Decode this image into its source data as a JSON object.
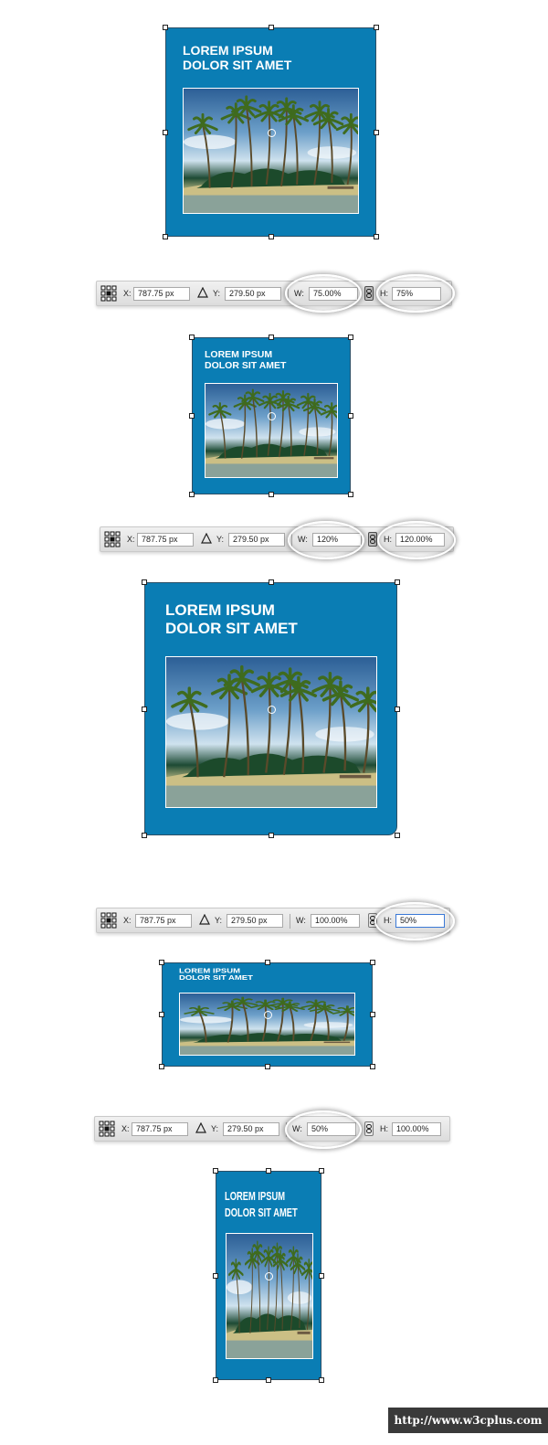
{
  "design_card": {
    "title_line1": "LOREM IPSUM",
    "title_line2": "DOLOR SIT AMET",
    "background_color": "#0a7db4",
    "photo": "tropical-island-palm-trees"
  },
  "toolbars": [
    {
      "x_label": "X:",
      "x_value": "787.75 px",
      "y_label": "Y:",
      "y_value": "279.50 px",
      "w_label": "W:",
      "w_value": "75.00%",
      "h_label": "H:",
      "h_value": "75%",
      "link_enabled": true,
      "highlighted": [
        "W",
        "H"
      ]
    },
    {
      "x_label": "X:",
      "x_value": "787.75 px",
      "y_label": "Y:",
      "y_value": "279.50 px",
      "w_label": "W:",
      "w_value": "120%",
      "h_label": "H:",
      "h_value": "120.00%",
      "link_enabled": true,
      "highlighted": [
        "W",
        "H"
      ]
    },
    {
      "x_label": "X:",
      "x_value": "787.75 px",
      "y_label": "Y:",
      "y_value": "279.50 px",
      "w_label": "W:",
      "w_value": "100.00%",
      "h_label": "H:",
      "h_value": "50%",
      "link_enabled": false,
      "highlighted": [
        "H"
      ]
    },
    {
      "x_label": "X:",
      "x_value": "787.75 px",
      "y_label": "Y:",
      "y_value": "279.50 px",
      "w_label": "W:",
      "w_value": "50%",
      "h_label": "H:",
      "h_value": "100.00%",
      "link_enabled": false,
      "highlighted": [
        "W"
      ]
    }
  ],
  "watermark": {
    "text": "http://www.w3cplus.com"
  },
  "icons": {
    "reference_point": "reference-point-grid-icon",
    "delta": "delta-triangle-icon",
    "link": "chain-link-icon"
  }
}
